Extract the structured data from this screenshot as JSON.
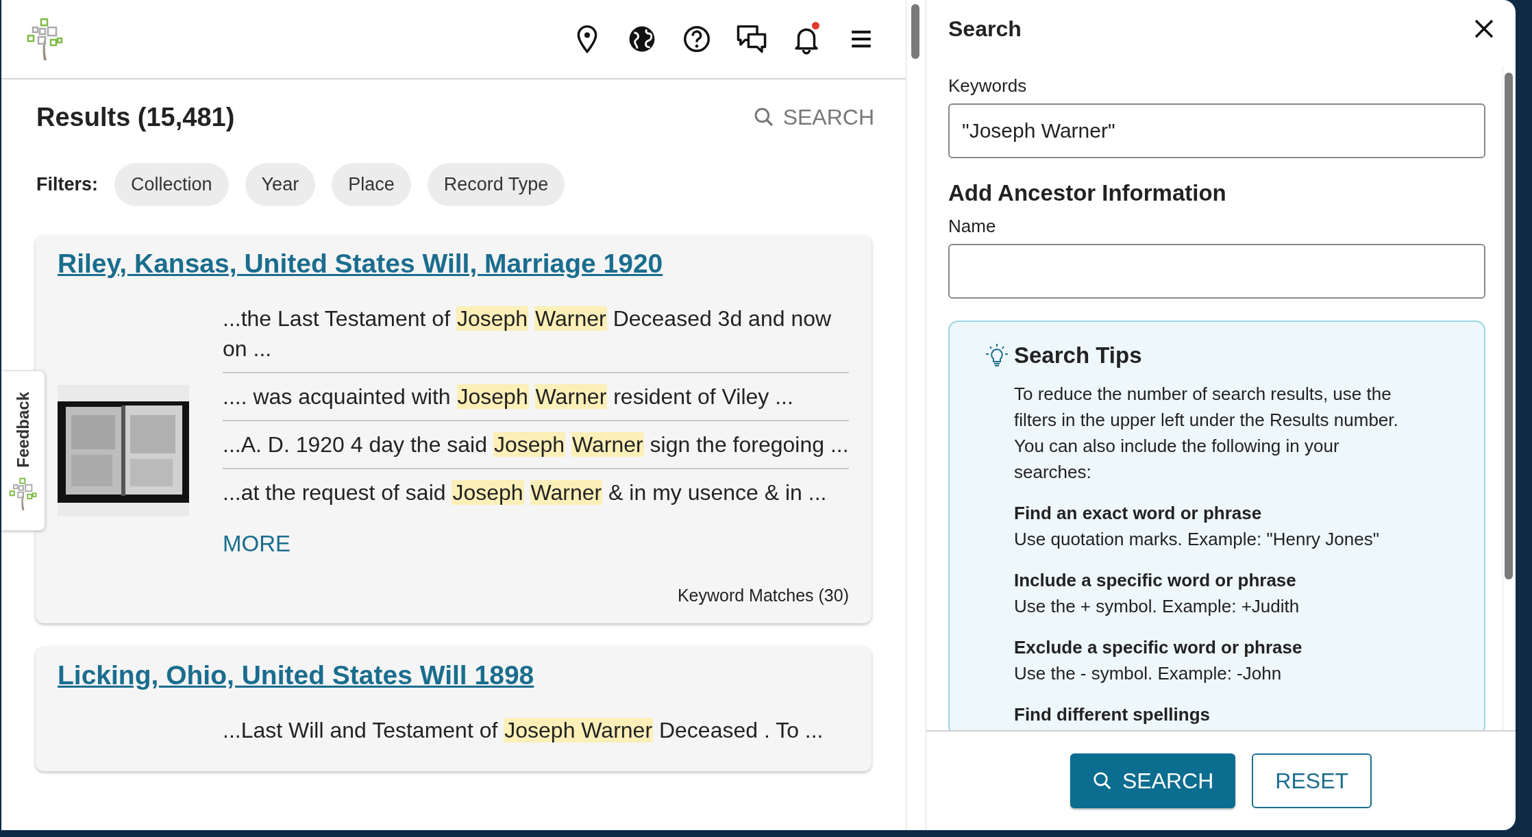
{
  "header": {
    "icons": [
      {
        "kind": "pin",
        "badge": false
      },
      {
        "kind": "globe",
        "badge": false
      },
      {
        "kind": "help",
        "badge": false
      },
      {
        "kind": "chat",
        "badge": false
      },
      {
        "kind": "bell",
        "badge": true
      },
      {
        "kind": "menu",
        "badge": false
      }
    ]
  },
  "results": {
    "title": "Results (15,481)",
    "search_link": "SEARCH",
    "filters_label": "Filters:",
    "filters": [
      "Collection",
      "Year",
      "Place",
      "Record Type"
    ],
    "items": [
      {
        "title": "Riley, Kansas, United States Will, Marriage 1920",
        "snippets": [
          [
            {
              "text": "...the Last Testament of ",
              "highlight": false
            },
            {
              "text": "Joseph",
              "highlight": true
            },
            {
              "text": "Warner",
              "highlight": true
            },
            {
              "text": " Deceased 3d and now on ...",
              "highlight": false
            }
          ],
          [
            {
              "text": ".... was acquainted with ",
              "highlight": false
            },
            {
              "text": "Joseph",
              "highlight": true
            },
            {
              "text": "Warner",
              "highlight": true
            },
            {
              "text": " resident of Viley ...",
              "highlight": false
            }
          ],
          [
            {
              "text": "...A. D. 1920 4 day the said ",
              "highlight": false
            },
            {
              "text": "Joseph",
              "highlight": true
            },
            {
              "text": "Warner",
              "highlight": true
            },
            {
              "text": " sign the foregoing ...",
              "highlight": false
            }
          ],
          [
            {
              "text": "...at the request of said ",
              "highlight": false
            },
            {
              "text": "Joseph",
              "highlight": true
            },
            {
              "text": "Warner",
              "highlight": true
            },
            {
              "text": " & in my usence & in ...",
              "highlight": false
            }
          ]
        ],
        "more": "MORE",
        "matches": "Keyword Matches (30)"
      },
      {
        "title": "Licking, Ohio, United States Will 1898",
        "snippets": [
          [
            {
              "text": "...Last Will and Testament of ",
              "highlight": false
            },
            {
              "text": "Joseph Warner",
              "highlight": true
            },
            {
              "text": " Deceased . To ...",
              "highlight": false
            }
          ]
        ]
      }
    ]
  },
  "feedback": {
    "label": "Feedback"
  },
  "search_panel": {
    "title": "Search",
    "keywords_label": "Keywords",
    "keywords_value": "\"Joseph Warner\"",
    "ancestor_heading": "Add Ancestor Information",
    "name_label": "Name",
    "tips": {
      "title": "Search Tips",
      "intro": "To reduce the number of search results, use the filters in the upper left under the Results number. You can also include the following in your searches:",
      "items": [
        {
          "heading": "Find an exact word or phrase",
          "text": "Use quotation marks. Example: \"Henry Jones\""
        },
        {
          "heading": "Include a specific word or phrase",
          "text": "Use the + symbol. Example: +Judith"
        },
        {
          "heading": "Exclude a specific word or phrase",
          "text": "Use the - symbol. Example: -John"
        },
        {
          "heading": "Find different spellings"
        }
      ]
    },
    "buttons": [
      {
        "kind": "primary",
        "label": "SEARCH"
      },
      {
        "kind": "secondary",
        "label": "RESET"
      }
    ]
  }
}
